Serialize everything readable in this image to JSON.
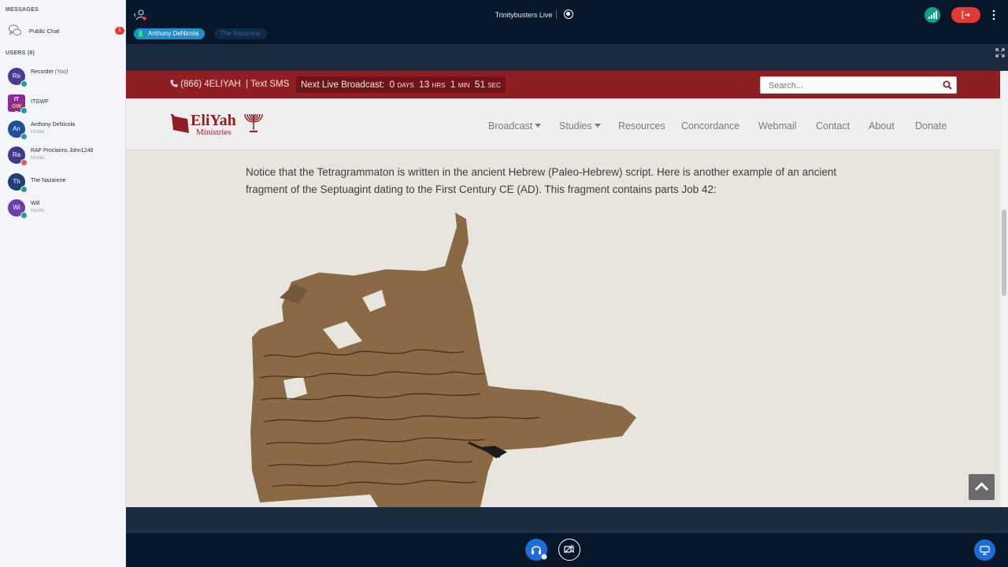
{
  "sidebar": {
    "messages_heading": "MESSAGES",
    "public_chat": {
      "label": "Public Chat",
      "unread": "1"
    },
    "users_heading": "USERS (6)",
    "users": [
      {
        "initials": "Re",
        "name": "Recorder",
        "tag": "(You)",
        "sub": "",
        "color": "#4a3a94"
      },
      {
        "initials": "IT GW F",
        "name": "ITGWF",
        "tag": "",
        "sub": "",
        "color": "#8e2aa0"
      },
      {
        "initials": "An",
        "name": "Anthony DeNicola",
        "tag": "",
        "sub": "Mobile",
        "color": "#1f4e9e"
      },
      {
        "initials": "Ra",
        "name": "RAF Proclaims John1248",
        "tag": "",
        "sub": "Mobile",
        "color": "#3f3a8f"
      },
      {
        "initials": "Th",
        "name": "The Nazarene",
        "tag": "",
        "sub": "",
        "color": "#1f3e7a"
      },
      {
        "initials": "Wi",
        "name": "Will",
        "tag": "",
        "sub": "Mobile",
        "color": "#6b3fb0"
      }
    ]
  },
  "topbar": {
    "title": "Trinitybusters Live",
    "presenter": "Anthony DeNicola",
    "speaker": "The Nazarene"
  },
  "website": {
    "phone": "(866) 4ELIYAH",
    "sms": "| Text SMS",
    "broadcast": {
      "label": "Next Live Broadcast:",
      "days": "0",
      "days_unit": "DAYS",
      "hrs": "13",
      "hrs_unit": "HRS",
      "min": "1",
      "min_unit": "MIN",
      "sec": "51",
      "sec_unit": "SEC"
    },
    "search_placeholder": "Search...",
    "logo_text": "EliYah",
    "logo_sub": "Ministries",
    "nav": [
      "Broadcast",
      "Studies",
      "Resources",
      "Concordance",
      "Webmail",
      "Contact",
      "About",
      "Donate"
    ],
    "article": "Notice that the Tetragrammaton is written in the ancient Hebrew (Paleo-Hebrew) script. Here is another example of an ancient fragment of the Septuagint dating to the First Century CE (AD). This fragment contains parts  Job 42:"
  },
  "colors": {
    "accent_red": "#8f1f24",
    "primary_blue": "#1e6dd6",
    "leave_red": "#e53935"
  }
}
